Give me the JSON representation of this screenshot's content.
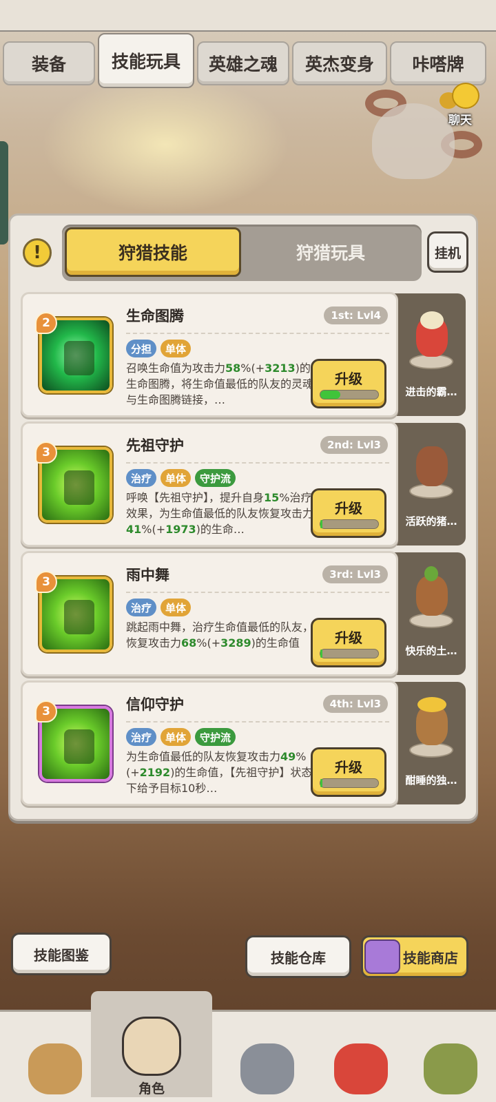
{
  "tabs": [
    {
      "label": "装备"
    },
    {
      "label": "技能玩具"
    },
    {
      "label": "英雄之魂"
    },
    {
      "label": "英杰变身"
    },
    {
      "label": "咔嗒牌"
    }
  ],
  "chat": {
    "label": "聊天"
  },
  "segment": {
    "left": "狩猎技能",
    "right": "狩猎玩具"
  },
  "idle_button": "挂机",
  "skills": [
    {
      "badge": "2",
      "name": "生命图腾",
      "rank": "1st: Lvl4",
      "tags": [
        {
          "text": "分担"
        },
        {
          "text": "单体"
        }
      ],
      "desc_parts": [
        "召唤生命值为攻击力",
        "58",
        "%(+",
        "3213",
        ")的生命图腾，将生命值最低的队友的灵魂与生命图腾链接，…"
      ],
      "upgrade": "升级",
      "progress": 0.35,
      "pet": "进击的霸…"
    },
    {
      "badge": "3",
      "name": "先祖守护",
      "rank": "2nd: Lvl3",
      "tags": [
        {
          "text": "治疗"
        },
        {
          "text": "单体"
        },
        {
          "text": "守护流"
        }
      ],
      "desc_parts": [
        "呼唤【先祖守护】，提升自身",
        "15",
        "%治疗效果，为生命值最低的队友恢复攻击力",
        "41",
        "%(+",
        "1973",
        ")的生命…"
      ],
      "upgrade": "升级",
      "progress": 0.04,
      "pet": "活跃的猪…"
    },
    {
      "badge": "3",
      "name": "雨中舞",
      "rank": "3rd: Lvl3",
      "tags": [
        {
          "text": "治疗"
        },
        {
          "text": "单体"
        }
      ],
      "desc_parts": [
        "跳起雨中舞，治疗生命值最低的队友，恢复攻击力",
        "68",
        "%(+",
        "3289",
        ")的生命值"
      ],
      "upgrade": "升级",
      "progress": 0.04,
      "pet": "快乐的土…"
    },
    {
      "badge": "3",
      "name": "信仰守护",
      "rank": "4th: Lvl3",
      "tags": [
        {
          "text": "治疗"
        },
        {
          "text": "单体"
        },
        {
          "text": "守护流"
        }
      ],
      "desc_parts": [
        "为生命值最低的队友恢复攻击力",
        "49",
        "%(+",
        "2192",
        ")的生命值，【先祖守护】状态下给予目标10秒…"
      ],
      "upgrade": "升级",
      "progress": 0.04,
      "pet": "酣睡的独…"
    }
  ],
  "bottom_buttons": {
    "codex": "技能图鉴",
    "storage": "技能仓库",
    "shop": "技能商店"
  },
  "nav": {
    "active_label": "角色"
  },
  "colors": {
    "accent_yellow": "#f5d45a",
    "value_green": "#2d8a2c",
    "tag_blue": "#5f8fc7",
    "tag_orange": "#e1a437",
    "tag_green": "#3b9a3e"
  }
}
